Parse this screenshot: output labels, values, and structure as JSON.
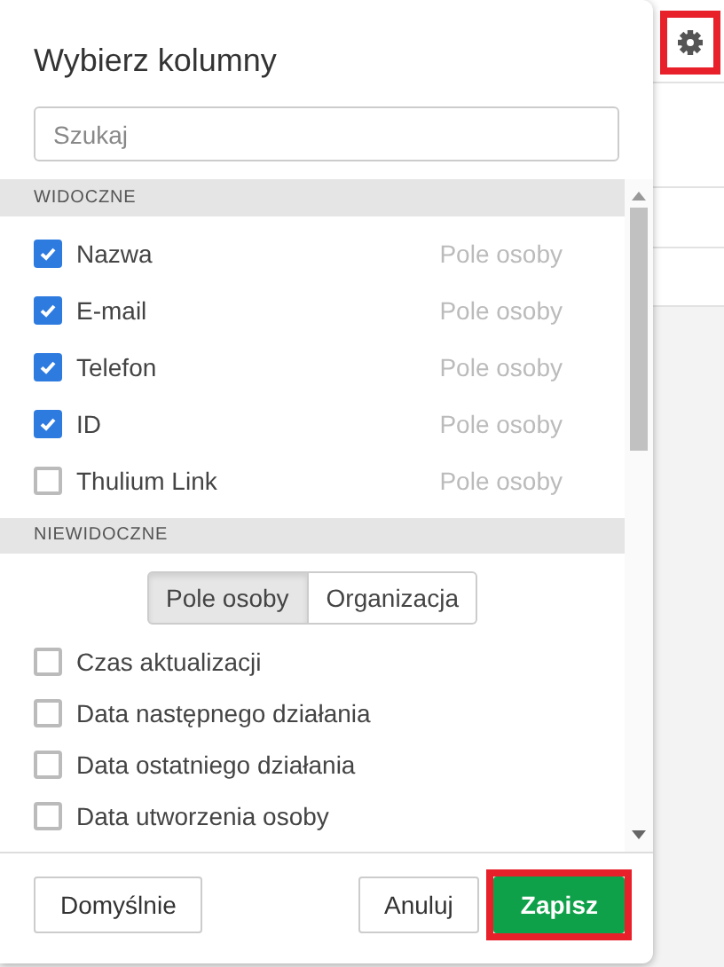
{
  "settings_button": {
    "highlighted": true
  },
  "dialog": {
    "title": "Wybierz kolumny",
    "search": {
      "placeholder": "Szukaj"
    },
    "sections": [
      {
        "heading": "WIDOCZNE",
        "items": [
          {
            "label": "Nazwa",
            "type": "Pole osoby",
            "checked": true
          },
          {
            "label": "E-mail",
            "type": "Pole osoby",
            "checked": true
          },
          {
            "label": "Telefon",
            "type": "Pole osoby",
            "checked": true
          },
          {
            "label": "ID",
            "type": "Pole osoby",
            "checked": true
          },
          {
            "label": "Thulium Link",
            "type": "Pole osoby",
            "checked": false
          }
        ]
      },
      {
        "heading": "NIEWIDOCZNE",
        "segments": [
          {
            "label": "Pole osoby",
            "selected": true
          },
          {
            "label": "Organizacja",
            "selected": false
          }
        ],
        "items": [
          {
            "label": "Czas aktualizacji",
            "checked": false
          },
          {
            "label": "Data następnego działania",
            "checked": false
          },
          {
            "label": "Data ostatniego działania",
            "checked": false
          },
          {
            "label": "Data utworzenia osoby",
            "checked": false
          }
        ]
      }
    ],
    "buttons": [
      {
        "label": "Domyślnie",
        "kind": "secondary",
        "highlighted": false
      },
      {
        "label": "Anuluj",
        "kind": "secondary",
        "highlighted": false
      },
      {
        "label": "Zapisz",
        "kind": "primary",
        "highlighted": true
      }
    ]
  }
}
